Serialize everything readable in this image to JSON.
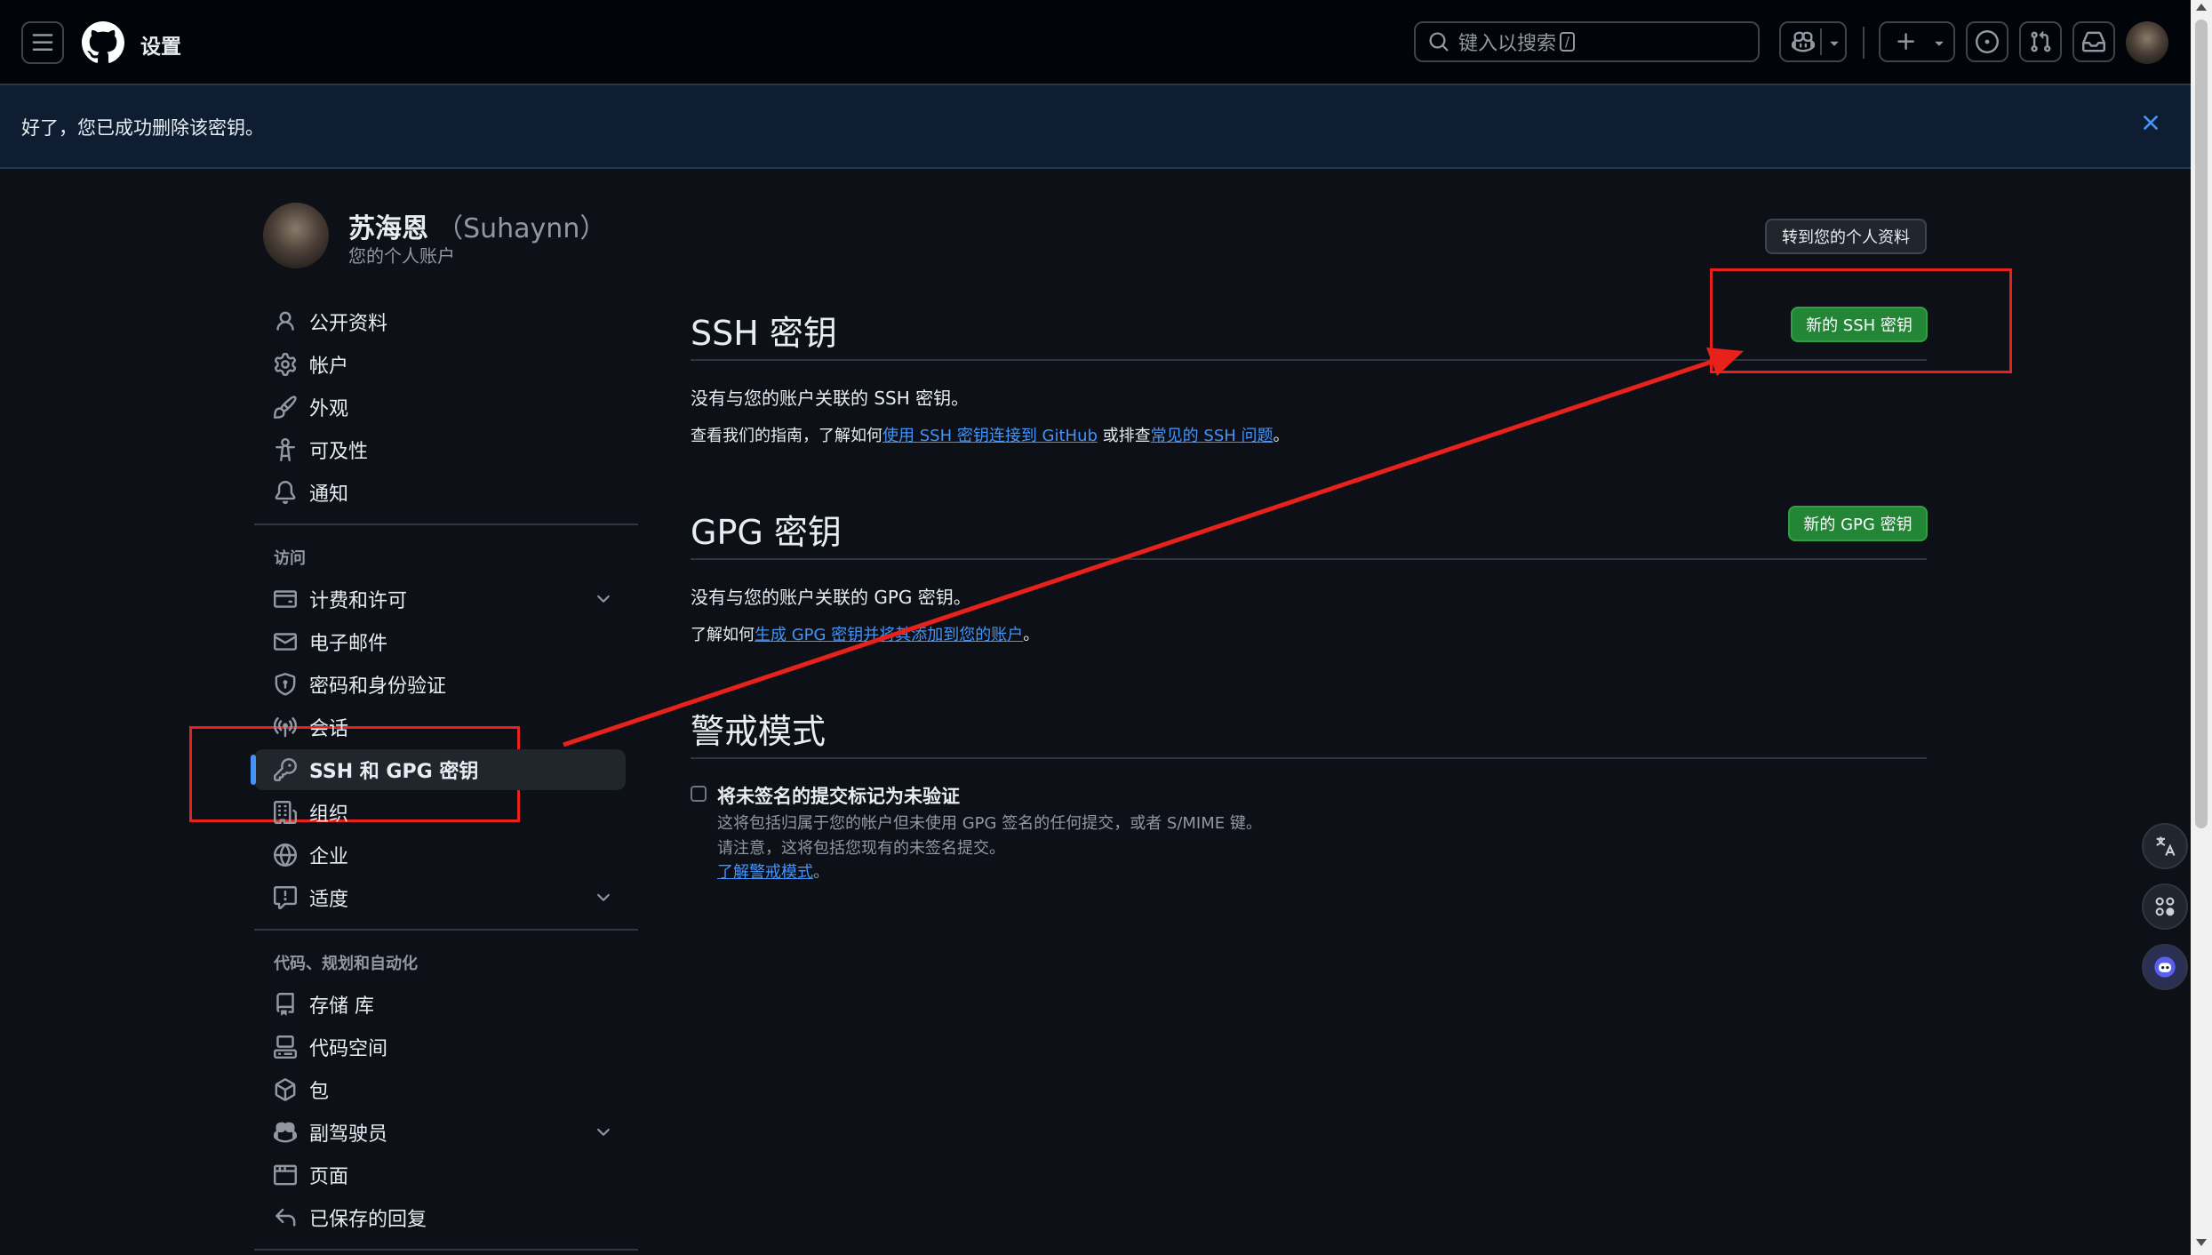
{
  "header": {
    "title": "设置",
    "search_placeholder": "键入以搜索",
    "search_shortcut": "/"
  },
  "flash": {
    "message": "好了，您已成功删除该密钥。"
  },
  "profile": {
    "name": "苏海恩",
    "username": "（Suhaynn）",
    "subtitle": "您的个人账户",
    "go_to_profile": "转到您的个人资料"
  },
  "sidebar": {
    "items_top": [
      {
        "label": "公开资料",
        "icon": "person-icon"
      },
      {
        "label": "帐户",
        "icon": "gear-icon"
      },
      {
        "label": "外观",
        "icon": "paintbrush-icon"
      },
      {
        "label": "可及性",
        "icon": "accessibility-icon"
      },
      {
        "label": "通知",
        "icon": "bell-icon"
      }
    ],
    "section_access": "访问",
    "items_access": [
      {
        "label": "计费和许可",
        "icon": "credit-card-icon"
      },
      {
        "label": "电子邮件",
        "icon": "mail-icon"
      },
      {
        "label": "密码和身份验证",
        "icon": "shield-lock-icon"
      },
      {
        "label": "会话",
        "icon": "broadcast-icon"
      },
      {
        "label": "SSH 和 GPG 密钥",
        "icon": "key-icon"
      },
      {
        "label": "组织",
        "icon": "organization-icon"
      },
      {
        "label": "企业",
        "icon": "globe-icon"
      },
      {
        "label": "适度",
        "icon": "report-icon"
      }
    ],
    "section_code": "代码、规划和自动化",
    "items_code": [
      {
        "label": "存储 库",
        "icon": "repo-icon"
      },
      {
        "label": "代码空间",
        "icon": "codespaces-icon"
      },
      {
        "label": "包",
        "icon": "package-icon"
      },
      {
        "label": "副驾驶员",
        "icon": "copilot-icon"
      },
      {
        "label": "页面",
        "icon": "browser-icon"
      },
      {
        "label": "已保存的回复",
        "icon": "reply-icon"
      }
    ]
  },
  "ssh": {
    "title": "SSH 密钥",
    "new_button": "新的 SSH 密钥",
    "empty": "没有与您的账户关联的 SSH 密钥。",
    "guide_prefix": "查看我们的指南，了解如何",
    "guide_link1": "使用 SSH 密钥连接到 GitHub",
    "guide_mid": " 或排查",
    "guide_link2": "常见的 SSH 问题",
    "guide_suffix": "。"
  },
  "gpg": {
    "title": "GPG 密钥",
    "new_button": "新的 GPG 密钥",
    "empty": "没有与您的账户关联的 GPG 密钥。",
    "learn_prefix": "了解如何",
    "learn_link": "生成 GPG 密钥并将其添加到您的账户",
    "learn_suffix": "。"
  },
  "vigilant": {
    "title": "警戒模式",
    "checkbox_label": "将未签名的提交标记为未验证",
    "desc1": "这将包括归属于您的帐户但未使用 GPG 签名的任何提交，或者 S/MIME 键。",
    "desc2": "请注意，这将包括您现有的未签名提交。",
    "learn_link": "了解警戒模式",
    "learn_suffix": "。"
  },
  "colors": {
    "accent": "#4493f8",
    "green": "#238636",
    "annotation_red": "#e8221b",
    "background": "#0d1117"
  }
}
